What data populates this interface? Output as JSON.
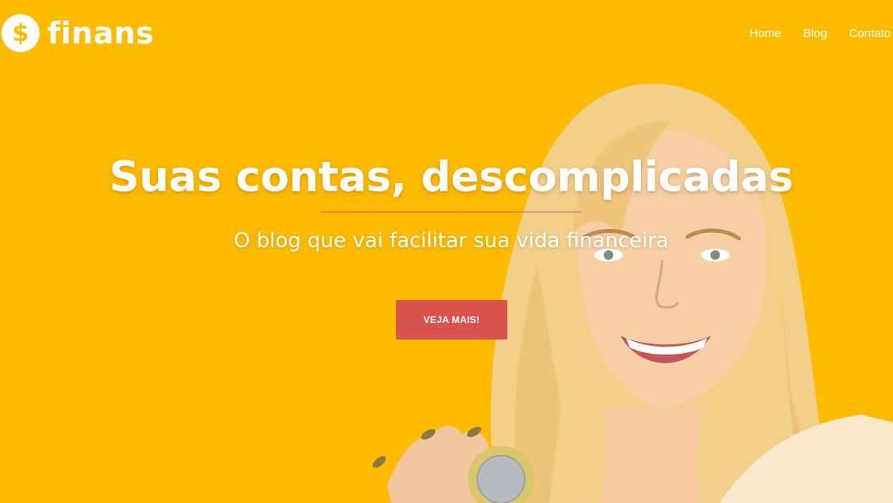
{
  "brand": {
    "name": "finans",
    "icon": "dollar-sign-icon",
    "icon_glyph": "$"
  },
  "nav": {
    "items": [
      "Home",
      "Blog",
      "Contato"
    ]
  },
  "hero": {
    "title": "Suas contas, descomplicadas",
    "subtitle": "O blog que vai facilitar sua vida financeira",
    "cta_label": "VEJA MAIS!"
  },
  "colors": {
    "background": "#FFBB00",
    "accent": "#D9534F",
    "text": "#FFFFFF"
  }
}
